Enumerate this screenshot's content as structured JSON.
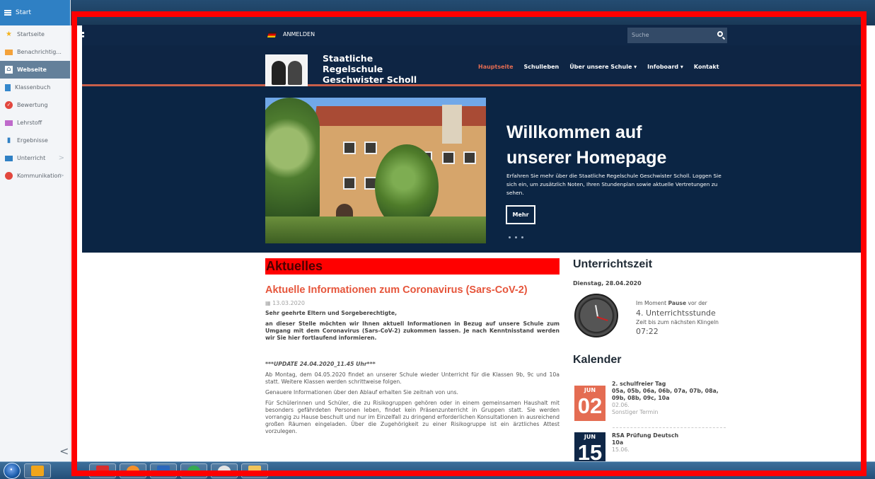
{
  "sidebar": {
    "header": "Start",
    "items": [
      {
        "label": "Startseite",
        "icon": "star-icon",
        "active": false
      },
      {
        "label": "Benachrichtig...",
        "icon": "envelope-icon",
        "active": false
      },
      {
        "label": "Webseite",
        "icon": "home-icon",
        "active": true
      },
      {
        "label": "Klassenbuch",
        "icon": "book-icon",
        "active": false
      },
      {
        "label": "Bewertung",
        "icon": "check-icon",
        "active": false
      },
      {
        "label": "Lehrstoff",
        "icon": "folder-icon",
        "active": false
      },
      {
        "label": "Ergebnisse",
        "icon": "bar-chart-icon",
        "active": false
      },
      {
        "label": "Unterricht",
        "icon": "classroom-icon",
        "active": false,
        "chevron": ">"
      },
      {
        "label": "Kommunikation",
        "icon": "chat-icon",
        "active": false,
        "chevron": ">"
      }
    ],
    "collapse": "<"
  },
  "site": {
    "top_bar": {
      "login": "ANMELDEN",
      "search_placeholder": "Suche"
    },
    "school_name": [
      "Staatliche",
      "Regelschule",
      "Geschwister Scholl"
    ],
    "nav": [
      "Hauptseite",
      "Schulleben",
      "Über unsere Schule ▾",
      "Infoboard ▾",
      "Kontakt"
    ],
    "hero": {
      "title": [
        "Willkommen auf",
        "unserer Homepage"
      ],
      "text": "Erfahren Sie mehr über die Staatliche Regelschule Geschwister Scholl. Loggen Sie sich ein, um zusätzlich Noten, Ihren Stundenplan sowie aktuelle Vertretungen zu sehen.",
      "button": "Mehr"
    },
    "main": {
      "section_title": "Aktuelles",
      "article_title": "Aktuelle Informationen zum Coronavirus (Sars-CoV-2)",
      "date": "13.03.2020",
      "greeting": "Sehr geehrte Eltern und Sorgeberechtigte,",
      "intro": "an dieser Stelle möchten wir Ihnen aktuell Informationen in Bezug auf unsere Schule zum Umgang mit dem Coronavirus (Sars-CoV-2) zukommen lassen. Je nach Kenntnisstand werden wir Sie hier fortlaufend informieren.",
      "update": "***UPDATE 24.04.2020_11.45 Uhr***",
      "p1": "Ab Montag, dem 04.05.2020 findet an unserer Schule wieder Unterricht für die Klassen 9b, 9c und 10a statt. Weitere Klassen werden schrittweise folgen.",
      "p2": "Genauere Informationen über den Ablauf erhalten Sie zeitnah von uns.",
      "p3": "Für Schülerinnen und Schüler, die zu Risikogruppen gehören oder in einem gemeinsamen Haushalt mit besonders gefährdeten Personen leben, findet kein Präsenzunterricht in Gruppen statt. Sie werden vorrangig zu Hause beschult und nur im Einzelfall zu dringend erforderlichen Konsultationen in ausreichend großen Räumen eingeladen. Über die Zugehörigkeit zu einer Risikogruppe ist ein ärztliches Attest vorzulegen."
    },
    "aside": {
      "time_title": "Unterrichtszeit",
      "day": "Dienstag, 28.04.2020",
      "moment_prefix": "Im Moment",
      "moment_status": "Pause",
      "moment_suffix": "vor der",
      "lesson": "4. Unterrichtsstunde",
      "next_text": "Zeit bis zum nächsten Klingeln",
      "remaining": "07:22",
      "calendar_title": "Kalender",
      "events": [
        {
          "month": "JUN",
          "day": "02",
          "title": "2. schulfreier Tag",
          "classes": "05a, 05b, 06a, 06b, 07a, 07b, 08a, 09b, 08b, 09c, 10a",
          "date": "02.06.",
          "type": "Sonstiger Termin",
          "color": "#e46c52"
        },
        {
          "month": "JUN",
          "day": "15",
          "title": "RSA Prüfung Deutsch",
          "classes": "10a",
          "date": "15.06.",
          "type": "",
          "color": "#0f2747"
        }
      ]
    }
  },
  "colors": {
    "red_annotation": "#ff0000",
    "site_navy": "#0f2747",
    "accent": "#e6553b",
    "sidebar_blue": "#2f80c4"
  }
}
